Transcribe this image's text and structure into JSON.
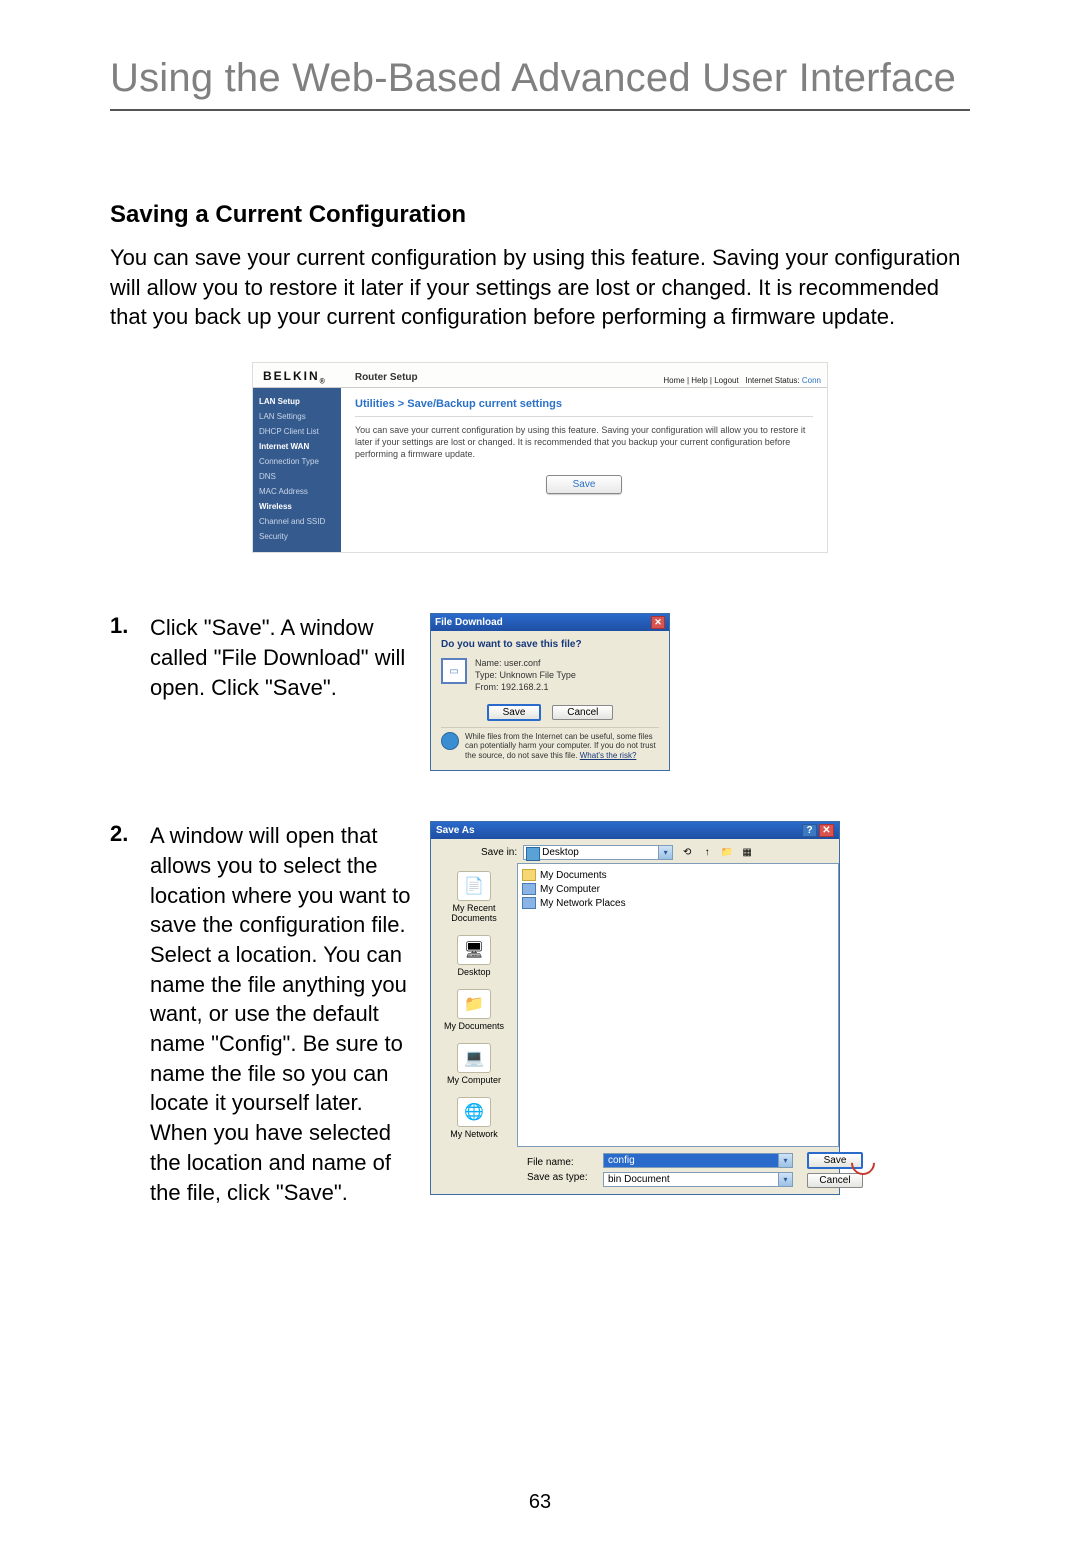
{
  "page": {
    "title": "Using the Web-Based Advanced User Interface",
    "number": "63"
  },
  "section": {
    "heading": "Saving a Current Configuration",
    "body": "You can save your current configuration by using this feature. Saving your configuration will allow you to restore it later if your settings are lost or changed. It is recommended that you back up your current configuration before performing a firmware update."
  },
  "router": {
    "logo": "BELKIN",
    "logo_sub": "®",
    "setup_label": "Router Setup",
    "nav_links": "Home | Help | Logout",
    "status_label": "Internet Status:",
    "status_value": "Conn",
    "sidebar": [
      {
        "label": "LAN Setup",
        "head": true
      },
      {
        "label": "LAN Settings"
      },
      {
        "label": "DHCP Client List"
      },
      {
        "label": "Internet WAN",
        "head": true
      },
      {
        "label": "Connection Type"
      },
      {
        "label": "DNS"
      },
      {
        "label": "MAC Address"
      },
      {
        "label": "Wireless",
        "head": true
      },
      {
        "label": "Channel and SSID"
      },
      {
        "label": "Security"
      }
    ],
    "breadcrumb": "Utilities > Save/Backup current settings",
    "main_text": "You can save your current configuration by using this feature. Saving your configuration will allow you to restore it later if your settings are lost or changed. It is recommended that you backup your current configuration before performing a firmware update.",
    "save_label": "Save"
  },
  "steps": {
    "s1_num": "1.",
    "s1_text": "Click \"Save\". A window called \"File Download\" will open. Click \"Save\".",
    "s2_num": "2.",
    "s2_text": "A window will open that allows you to select the location where you want to save the configuration file. Select a location. You can name the file anything you want, or use the default name \"Config\". Be sure to name the file so you can locate it yourself later. When you have selected the location and name of the file, click \"Save\"."
  },
  "fileDownload": {
    "title": "File Download",
    "question": "Do you want to save this file?",
    "name_label": "Name:",
    "name_value": "user.conf",
    "type_label": "Type:",
    "type_value": "Unknown File Type",
    "from_label": "From:",
    "from_value": "192.168.2.1",
    "save": "Save",
    "cancel": "Cancel",
    "warn": "While files from the Internet can be useful, some files can potentially harm your computer. If you do not trust the source, do not save this file.",
    "risk_link": "What's the risk?"
  },
  "saveAs": {
    "title": "Save As",
    "savein_label": "Save in:",
    "savein_value": "Desktop",
    "toolbar_icons": [
      "⟲",
      "↑",
      "📁",
      "▦"
    ],
    "places": [
      "My Recent Documents",
      "Desktop",
      "My Documents",
      "My Computer",
      "My Network"
    ],
    "list": [
      {
        "label": "My Documents",
        "kind": "folder"
      },
      {
        "label": "My Computer",
        "kind": "comp"
      },
      {
        "label": "My Network Places",
        "kind": "comp"
      }
    ],
    "filename_label": "File name:",
    "filename_value": "config",
    "savetype_label": "Save as type:",
    "savetype_value": "bin Document",
    "save": "Save",
    "cancel": "Cancel"
  }
}
